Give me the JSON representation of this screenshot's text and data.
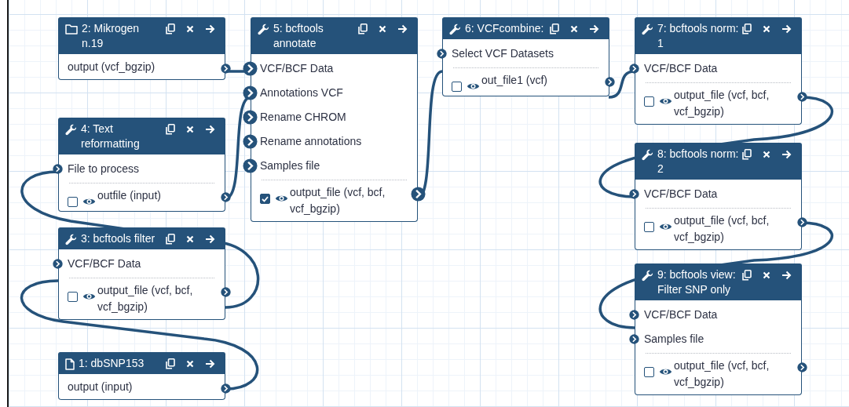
{
  "nodes": [
    {
      "kind": "collection",
      "title": "2: Mikrogen n.19",
      "outputs": [
        {
          "label": "output (vcf_bgzip)"
        }
      ]
    },
    {
      "kind": "tool",
      "title": "4: Text reformatting",
      "inputs": [
        "File to process"
      ],
      "outputs": [
        {
          "label": "outfile (input)",
          "checked": false
        }
      ]
    },
    {
      "kind": "tool",
      "title": "3: bcftools filter",
      "inputs": [
        "VCF/BCF Data"
      ],
      "outputs": [
        {
          "label": "output_file (vcf, bcf, vcf_bgzip)",
          "checked": false
        }
      ]
    },
    {
      "kind": "dataset",
      "title": "1: dbSNP153",
      "outputs": [
        {
          "label": "output (input)"
        }
      ]
    },
    {
      "kind": "tool",
      "title": "5: bcftools annotate",
      "inputs": [
        "VCF/BCF Data",
        "Annotations VCF",
        "Rename CHROM",
        "Rename annotations",
        "Samples file"
      ],
      "outputs": [
        {
          "label": "output_file (vcf, bcf, vcf_bgzip)",
          "checked": true
        }
      ]
    },
    {
      "kind": "tool",
      "title": "6: VCFcombine:",
      "inputs": [
        "Select VCF Datasets"
      ],
      "outputs": [
        {
          "label": "out_file1 (vcf)",
          "checked": false
        }
      ]
    },
    {
      "kind": "tool",
      "title": "7: bcftools norm: 1",
      "inputs": [
        "VCF/BCF Data"
      ],
      "outputs": [
        {
          "label": "output_file (vcf, bcf, vcf_bgzip)",
          "checked": false
        }
      ]
    },
    {
      "kind": "tool",
      "title": "8: bcftools norm: 2",
      "inputs": [
        "VCF/BCF Data"
      ],
      "outputs": [
        {
          "label": "output_file (vcf, bcf, vcf_bgzip)",
          "checked": false
        }
      ]
    },
    {
      "kind": "tool",
      "title": "9: bcftools view: Filter SNP only",
      "inputs": [
        "VCF/BCF Data",
        "Samples file"
      ],
      "outputs": [
        {
          "label": "output_file (vcf, bcf, vcf_bgzip)",
          "checked": false
        }
      ]
    }
  ]
}
